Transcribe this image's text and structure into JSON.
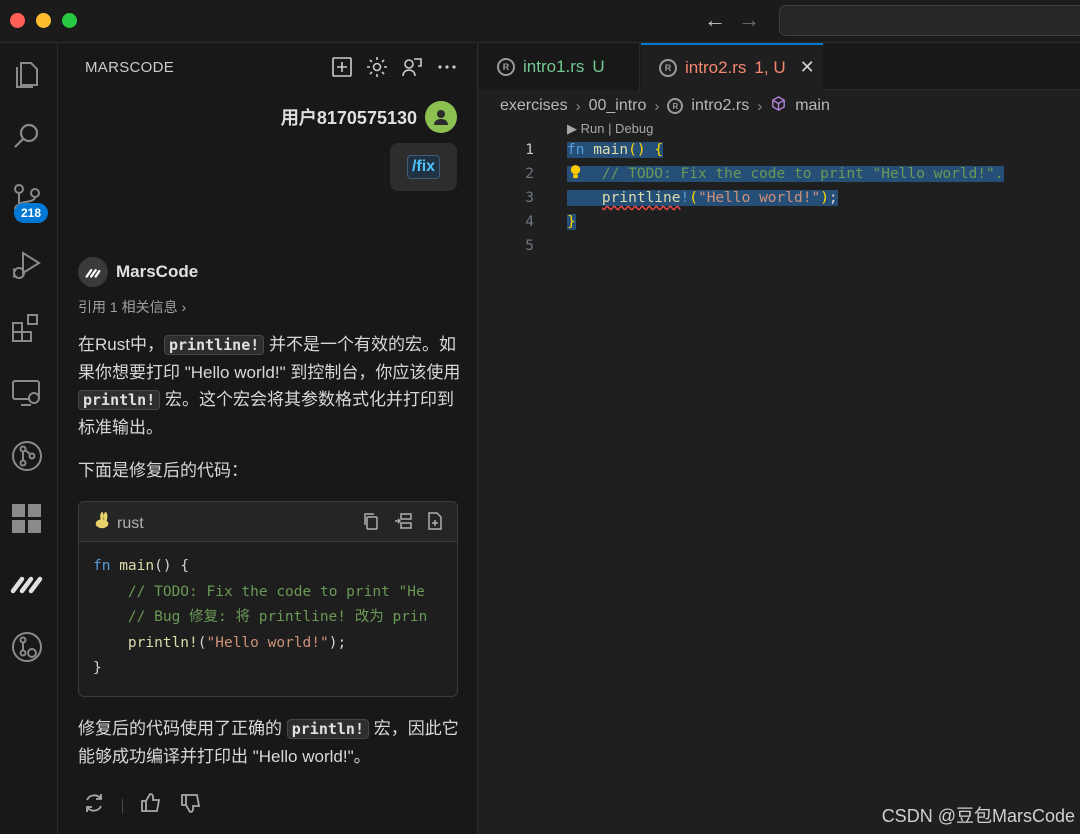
{
  "window": {
    "nav_back": "←",
    "nav_forward": "→"
  },
  "activity": {
    "source_control_badge": "218"
  },
  "panel": {
    "title": "MARSCODE",
    "user_name": "用户8170575130",
    "user_message": "/fix",
    "bot_name": "MarsCode",
    "reference": "引用 1 相关信息 ›",
    "p1_a": "在Rust中，",
    "p1_code1": "printline!",
    "p1_b": " 并不是一个有效的宏。如果你想要打印 \"Hello world!\" 到控制台，你应该使用 ",
    "p1_code2": "println!",
    "p1_c": " 宏。这个宏会将其参数格式化并打印到标准输出。",
    "p2": "下面是修复后的代码：",
    "code_lang": "rust",
    "code_lines": [
      "fn main() {",
      "    // TODO: Fix the code to print \"Hello world!\".",
      "    // Bug 修复: 将 printline! 改为 println!",
      "    println!(\"Hello world!\");",
      "}"
    ],
    "p3_a": "修复后的代码使用了正确的 ",
    "p3_code": "println!",
    "p3_b": " 宏，因此它能够成功编译并打印出 \"Hello world!\"。"
  },
  "editor": {
    "tabs": [
      {
        "name": "intro1.rs",
        "status": "U"
      },
      {
        "name": "intro2.rs",
        "status": "1, U"
      }
    ],
    "breadcrumb": [
      "exercises",
      "00_intro",
      "intro2.rs",
      "main"
    ],
    "run_lens": "▶ Run | Debug",
    "line_numbers": [
      "1",
      "2",
      "3",
      "4",
      "5"
    ]
  },
  "watermark": "CSDN @豆包MarsCode",
  "colors": {
    "accent": "#0078d4",
    "untracked": "#73c991",
    "error": "#f48771",
    "avatar": "#8cc152"
  }
}
